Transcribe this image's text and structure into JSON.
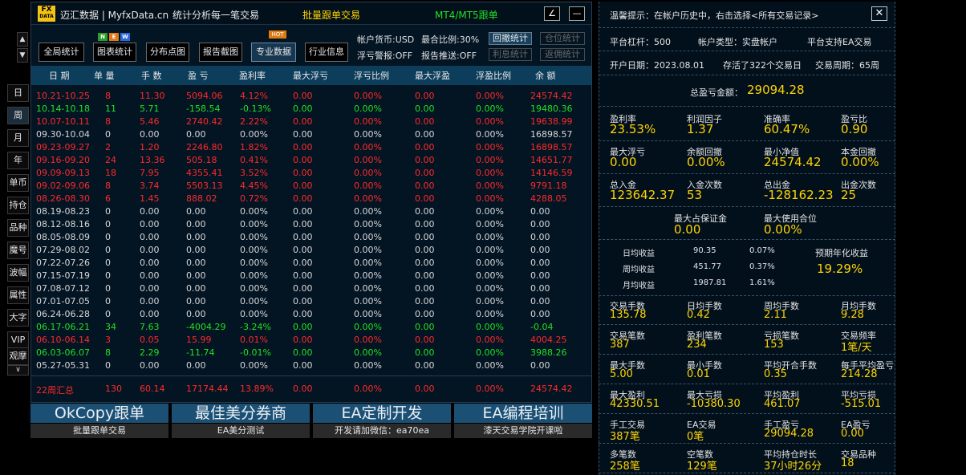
{
  "sidebar": {
    "period_buttons": [
      "日",
      "周",
      "月",
      "年"
    ],
    "function_buttons": [
      "单币",
      "持仓",
      "品种",
      "魔号",
      "波幅",
      "属性",
      "大字",
      "VIP",
      "观摩"
    ],
    "up_arrow": "▲",
    "down_arrow": "▼",
    "bottom_arrow": "∨"
  },
  "titlebar": {
    "logo_top": "FX",
    "logo_bottom": "DATA",
    "site": "迈汇数据 | MyfxData.cn",
    "slogan": "统计分析每一笔交易",
    "batch_copy": "批量跟单交易",
    "mt_copy": "MT4/MT5跟单",
    "edit_icon": "∠",
    "minimize_icon": "—"
  },
  "toolbar": {
    "buttons": [
      "全局统计",
      "图表统计",
      "分布点图",
      "报告截图",
      "专业数据",
      "行业信息"
    ],
    "new_badge": [
      "N",
      "E",
      "W"
    ],
    "hot_badge": "HOT",
    "currency": "帐户货币:USD",
    "max_ratio": "最合比例:30%",
    "float_alert": "浮亏警报:OFF",
    "report_push": "报告推送:OFF",
    "btn_withdraw_stats": "回撤统计",
    "btn_position_stats": "仓位统计",
    "btn_interest_stats": "利息统计",
    "btn_rebate_stats": "返佣统计"
  },
  "table": {
    "headers": [
      "日 期",
      "单 量",
      "手 数",
      "盈 亏",
      "盈利率",
      "最大浮亏",
      "浮亏比例",
      "最大浮盈",
      "浮盈比例",
      "余 额"
    ],
    "rows": [
      {
        "c": "red",
        "v": [
          "10.21-10.25",
          "8",
          "11.30",
          "5094.06",
          "4.12%",
          "0.00",
          "0.00%",
          "0.00",
          "0.00%",
          "24574.42"
        ]
      },
      {
        "c": "green",
        "v": [
          "10.14-10.18",
          "11",
          "5.71",
          "-158.54",
          "-0.13%",
          "0.00",
          "0.00%",
          "0.00",
          "0.00%",
          "19480.36"
        ]
      },
      {
        "c": "red",
        "v": [
          "10.07-10.11",
          "8",
          "5.46",
          "2740.42",
          "2.22%",
          "0.00",
          "0.00%",
          "0.00",
          "0.00%",
          "19638.99"
        ]
      },
      {
        "c": "white",
        "v": [
          "09.30-10.04",
          "0",
          "0.00",
          "0.00",
          "0.00%",
          "0.00",
          "0.00%",
          "0.00",
          "0.00%",
          "16898.57"
        ]
      },
      {
        "c": "red",
        "v": [
          "09.23-09.27",
          "2",
          "1.20",
          "2246.80",
          "1.82%",
          "0.00",
          "0.00%",
          "0.00",
          "0.00%",
          "16898.57"
        ]
      },
      {
        "c": "red",
        "v": [
          "09.16-09.20",
          "24",
          "13.36",
          "505.18",
          "0.41%",
          "0.00",
          "0.00%",
          "0.00",
          "0.00%",
          "14651.77"
        ]
      },
      {
        "c": "red",
        "v": [
          "09.09-09.13",
          "18",
          "7.95",
          "4355.41",
          "3.52%",
          "0.00",
          "0.00%",
          "0.00",
          "0.00%",
          "14146.59"
        ]
      },
      {
        "c": "red",
        "v": [
          "09.02-09.06",
          "8",
          "3.74",
          "5503.13",
          "4.45%",
          "0.00",
          "0.00%",
          "0.00",
          "0.00%",
          "9791.18"
        ]
      },
      {
        "c": "red",
        "v": [
          "08.26-08.30",
          "6",
          "1.45",
          "888.02",
          "0.72%",
          "0.00",
          "0.00%",
          "0.00",
          "0.00%",
          "4288.05"
        ]
      },
      {
        "c": "white",
        "v": [
          "08.19-08.23",
          "0",
          "0.00",
          "0.00",
          "0.00%",
          "0.00",
          "0.00%",
          "0.00",
          "0.00%",
          "0.00"
        ]
      },
      {
        "c": "white",
        "v": [
          "08.12-08.16",
          "0",
          "0.00",
          "0.00",
          "0.00%",
          "0.00",
          "0.00%",
          "0.00",
          "0.00%",
          "0.00"
        ]
      },
      {
        "c": "white",
        "v": [
          "08.05-08.09",
          "0",
          "0.00",
          "0.00",
          "0.00%",
          "0.00",
          "0.00%",
          "0.00",
          "0.00%",
          "0.00"
        ]
      },
      {
        "c": "white",
        "v": [
          "07.29-08.02",
          "0",
          "0.00",
          "0.00",
          "0.00%",
          "0.00",
          "0.00%",
          "0.00",
          "0.00%",
          "0.00"
        ]
      },
      {
        "c": "white",
        "v": [
          "07.22-07.26",
          "0",
          "0.00",
          "0.00",
          "0.00%",
          "0.00",
          "0.00%",
          "0.00",
          "0.00%",
          "0.00"
        ]
      },
      {
        "c": "white",
        "v": [
          "07.15-07.19",
          "0",
          "0.00",
          "0.00",
          "0.00%",
          "0.00",
          "0.00%",
          "0.00",
          "0.00%",
          "0.00"
        ]
      },
      {
        "c": "white",
        "v": [
          "07.08-07.12",
          "0",
          "0.00",
          "0.00",
          "0.00%",
          "0.00",
          "0.00%",
          "0.00",
          "0.00%",
          "0.00"
        ]
      },
      {
        "c": "white",
        "v": [
          "07.01-07.05",
          "0",
          "0.00",
          "0.00",
          "0.00%",
          "0.00",
          "0.00%",
          "0.00",
          "0.00%",
          "0.00"
        ]
      },
      {
        "c": "white",
        "v": [
          "06.24-06.28",
          "0",
          "0.00",
          "0.00",
          "0.00%",
          "0.00",
          "0.00%",
          "0.00",
          "0.00%",
          "0.00"
        ]
      },
      {
        "c": "green",
        "v": [
          "06.17-06.21",
          "34",
          "7.63",
          "-4004.29",
          "-3.24%",
          "0.00",
          "0.00%",
          "0.00",
          "0.00%",
          "-0.04"
        ]
      },
      {
        "c": "red",
        "v": [
          "06.10-06.14",
          "3",
          "0.05",
          "15.99",
          "0.01%",
          "0.00",
          "0.00%",
          "0.00",
          "0.00%",
          "4004.25"
        ]
      },
      {
        "c": "green",
        "v": [
          "06.03-06.07",
          "8",
          "2.29",
          "-11.74",
          "-0.01%",
          "0.00",
          "0.00%",
          "0.00",
          "0.00%",
          "3988.26"
        ]
      },
      {
        "c": "white",
        "v": [
          "05.27-05.31",
          "0",
          "0.00",
          "0.00",
          "0.00%",
          "0.00",
          "0.00%",
          "0.00",
          "0.00%",
          "0.00"
        ]
      }
    ],
    "summary": [
      "22周汇总",
      "130",
      "60.14",
      "17174.44",
      "13.89%",
      "0.00",
      "",
      "0.00%",
      "0.00",
      "0.00%",
      "24574.42"
    ]
  },
  "promo": [
    {
      "title": "OkCopy跟单",
      "sub": "批量跟单交易"
    },
    {
      "title": "最佳美分券商",
      "sub": "EA美分测试"
    },
    {
      "title": "EA定制开发",
      "sub": "开发请加微信：ea70ea"
    },
    {
      "title": "EA编程培训",
      "sub": "漆天交易学院开课啦"
    }
  ],
  "right": {
    "tip": "温馨提示：在帐户历史中，右击选择<所有交易记录>",
    "close_icon": "✕",
    "leverage": "平台杠杆：500",
    "account_type": "帐户类型：实盘帐户",
    "ea_support": "平台支持EA交易",
    "open_date": "开户日期：2023.08.01",
    "live_days": "存活了322个交易日",
    "trade_cycle": "交易周期：65周",
    "total_pl_label": "总盈亏金额：",
    "total_pl": "29094.28",
    "metrics1": [
      {
        "l": "盈利率",
        "v": "23.53%"
      },
      {
        "l": "利润因子",
        "v": "1.37"
      },
      {
        "l": "准确率",
        "v": "60.47%"
      },
      {
        "l": "盈亏比",
        "v": "0.90"
      },
      {
        "l": "最大浮亏",
        "v": "0.00"
      },
      {
        "l": "余额回撤",
        "v": "0.00%"
      },
      {
        "l": "最小净值",
        "v": "24574.42"
      },
      {
        "l": "本金回撤",
        "v": "0.00%"
      },
      {
        "l": "总入金",
        "v": "123642.37"
      },
      {
        "l": "入金次数",
        "v": "53"
      },
      {
        "l": "总出金",
        "v": "-128162.23"
      },
      {
        "l": "出金次数",
        "v": "25"
      }
    ],
    "margin": [
      {
        "l": "最大占保证金",
        "v": "0.00"
      },
      {
        "l": "最大使用合位",
        "v": "0.00%"
      }
    ],
    "income": [
      {
        "l": "日均收益",
        "a": "90.35",
        "p": "0.07%"
      },
      {
        "l": "周均收益",
        "a": "451.77",
        "p": "0.37%"
      },
      {
        "l": "月均收益",
        "a": "1987.81",
        "p": "1.61%"
      }
    ],
    "annual_label": "预期年化收益",
    "annual_value": "19.29%",
    "metrics2": [
      {
        "l": "交易手数",
        "v": "135.78"
      },
      {
        "l": "日均手数",
        "v": "0.42"
      },
      {
        "l": "周均手数",
        "v": "2.11"
      },
      {
        "l": "月均手数",
        "v": "9.28"
      },
      {
        "l": "交易笔数",
        "v": "387"
      },
      {
        "l": "盈利笔数",
        "v": "234"
      },
      {
        "l": "亏损笔数",
        "v": "153"
      },
      {
        "l": "交易频率",
        "v": "1笔/天"
      },
      {
        "l": "最大手数",
        "v": "5.00"
      },
      {
        "l": "最小手数",
        "v": "0.01"
      },
      {
        "l": "平均开合手数",
        "v": "0.35"
      },
      {
        "l": "每手平均盈亏",
        "v": "214.28"
      },
      {
        "l": "最大盈利",
        "v": "42330.51"
      },
      {
        "l": "最大亏损",
        "v": "-10380.30"
      },
      {
        "l": "平均盈利",
        "v": "461.07"
      },
      {
        "l": "平均亏损",
        "v": "-515.01"
      },
      {
        "l": "手工交易",
        "v": "387笔"
      },
      {
        "l": "EA交易",
        "v": "0笔"
      },
      {
        "l": "手工盈亏",
        "v": "29094.28"
      },
      {
        "l": "EA盈亏",
        "v": "0.00"
      },
      {
        "l": "多笔数",
        "v": "258笔"
      },
      {
        "l": "空笔数",
        "v": "129笔"
      },
      {
        "l": "平均持仓时长",
        "v": "37小时26分"
      },
      {
        "l": "交易品种",
        "v": "18"
      }
    ]
  }
}
